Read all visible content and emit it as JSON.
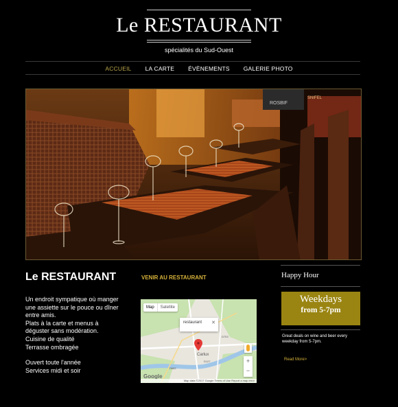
{
  "header": {
    "title": "Le RESTAURANT",
    "tagline": "spécialités du Sud-Ouest"
  },
  "nav": {
    "items": [
      {
        "label": "ACCUEIL",
        "active": true
      },
      {
        "label": "LA CARTE",
        "active": false
      },
      {
        "label": "ÉVÈNEMENTS",
        "active": false
      },
      {
        "label": "GALERIE PHOTO",
        "active": false
      }
    ]
  },
  "hero": {
    "sign_texts": [
      "ROSBIF",
      "SNIFEL"
    ]
  },
  "about": {
    "title": "Le RESTAURANT",
    "venir_link": "VENIR AU RESTAURANT",
    "lines": [
      "Un endroit sympatique où manger",
      "une assiette sur le pouce ou dîner",
      "entre amis.",
      "Plats à la carte et menus à",
      "déguster sans modération.",
      "Cuisine de qualité",
      "Terrasse ombragée"
    ],
    "lines2": [
      "Ouvert toute l'année",
      "Services midi et soir"
    ]
  },
  "map": {
    "btn_map": "Map",
    "btn_satellite": "Satellite",
    "info_text": "restaurant",
    "info_close": "✕",
    "town_label": "Carlux",
    "road_labels": [
      "D662",
      "D127",
      "D703"
    ],
    "zoom_in": "+",
    "zoom_out": "−",
    "logo": "Google",
    "footer": "Map data ©2017 Google   Terms of Use   Report a map error"
  },
  "happy_hour": {
    "title": "Happy Hour",
    "box_big": "Weekdays",
    "box_small": "from 5-7pm",
    "deals": "Great deals on wine and beer every weekday from 5-7pm.",
    "read_more": "Read More>"
  },
  "colors": {
    "accent_gold": "#d7b23a",
    "nav_active": "#b7a44a",
    "weekday_box": "#9a8512"
  }
}
